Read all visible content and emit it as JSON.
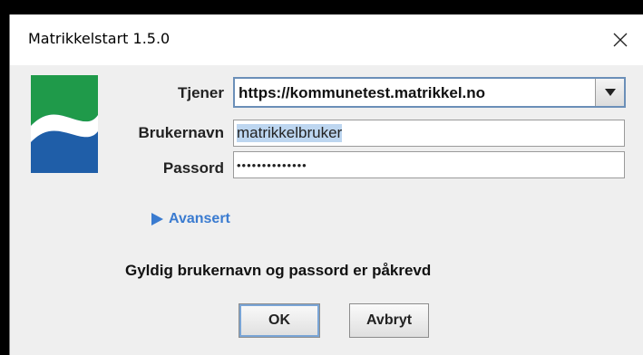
{
  "window": {
    "title": "Matrikkelstart 1.5.0"
  },
  "form": {
    "server_label": "Tjener",
    "server_value": "https://kommunetest.matrikkel.no",
    "username_label": "Brukernavn",
    "username_value": "matrikkelbruker",
    "password_label": "Passord",
    "password_value": "••••••••••••••"
  },
  "advanced": {
    "label": "Avansert"
  },
  "status": {
    "message": "Gyldig brukernavn og passord er påkrevd"
  },
  "buttons": {
    "ok_label": "OK",
    "cancel_label": "Avbryt"
  },
  "icons": {
    "logo": "municipality-logo-icon",
    "close": "close-icon",
    "dropdown": "chevron-down-icon",
    "expand": "triangle-right-icon"
  },
  "colors": {
    "logo_green": "#1f9a4a",
    "logo_blue": "#1f5ea8",
    "link_blue": "#3a7bd0",
    "focus_border": "#6b8fb8"
  }
}
